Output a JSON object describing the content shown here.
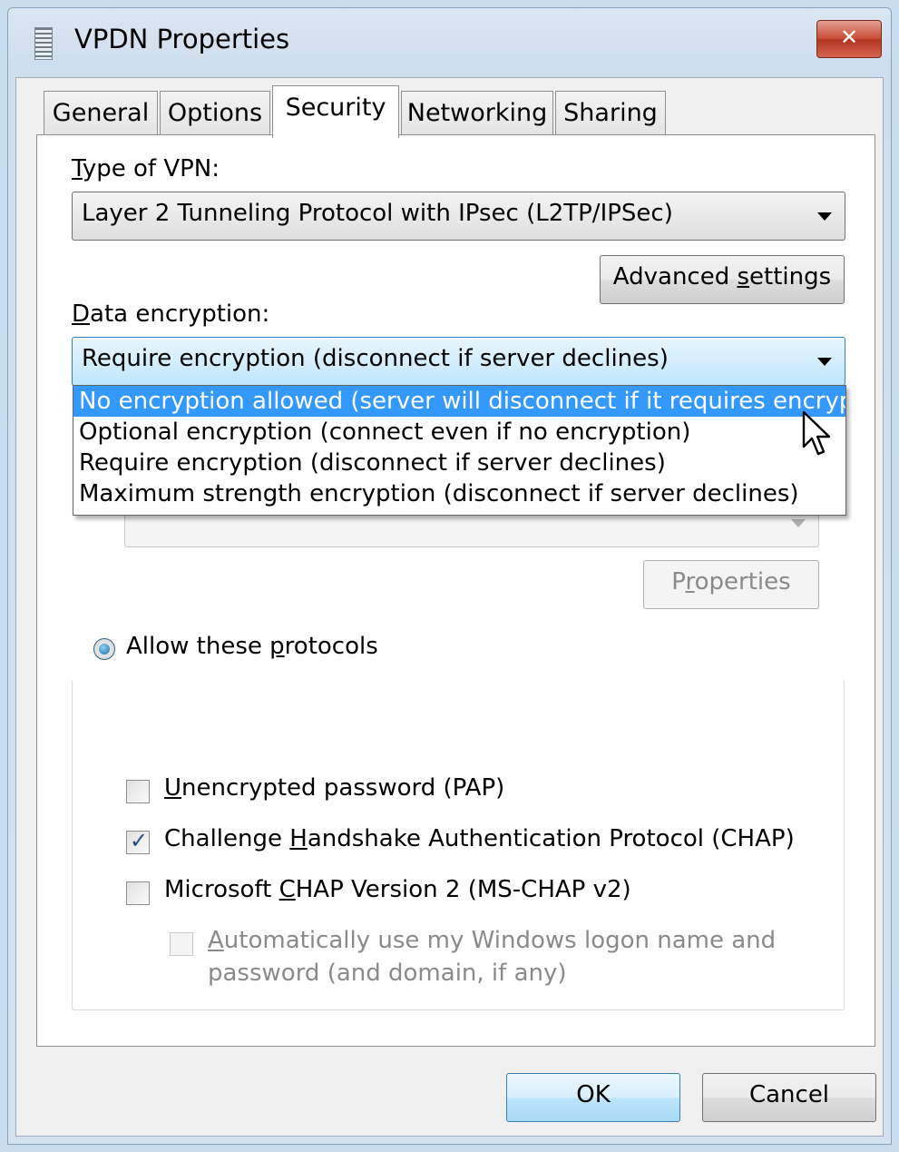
{
  "window": {
    "title": "VPDN Properties"
  },
  "tabs": [
    {
      "label": "General",
      "active": false
    },
    {
      "label": "Options",
      "active": false
    },
    {
      "label": "Security",
      "active": true
    },
    {
      "label": "Networking",
      "active": false
    },
    {
      "label": "Sharing",
      "active": false
    }
  ],
  "security": {
    "vpn_type_label_prefix": "T",
    "vpn_type_label_rest": "ype of VPN:",
    "vpn_type_value": "Layer 2 Tunneling Protocol with IPsec (L2TP/IPSec)",
    "advanced_settings_label_pre": "Advanced ",
    "advanced_settings_label_u": "s",
    "advanced_settings_label_post": "ettings",
    "data_encryption_label_prefix": "D",
    "data_encryption_label_rest": "ata encryption:",
    "data_encryption_value": "Require encryption (disconnect if server declines)",
    "data_encryption_options": [
      {
        "label": "No encryption allowed (server will disconnect if it requires encryption)",
        "highlighted": true
      },
      {
        "label": "Optional encryption (connect even if no encryption)",
        "highlighted": false
      },
      {
        "label": "Require encryption (disconnect if server declines)",
        "highlighted": false
      },
      {
        "label": "Maximum strength encryption (disconnect if server declines)",
        "highlighted": false
      }
    ],
    "properties_label_pre": "P",
    "properties_label_u": "r",
    "properties_label_post": "operties",
    "allow_protocols_pre": "Allow these ",
    "allow_protocols_u": "p",
    "allow_protocols_post": "rotocols",
    "allow_protocols_selected": true,
    "protocols": [
      {
        "pre": "",
        "u": "U",
        "post": "nencrypted password (PAP)",
        "checked": false,
        "enabled": true
      },
      {
        "pre": "Challenge ",
        "u": "H",
        "post": "andshake Authentication Protocol (CHAP)",
        "checked": true,
        "enabled": true
      },
      {
        "pre": "Microsoft ",
        "u": "C",
        "post": "HAP Version 2 (MS-CHAP v2)",
        "checked": false,
        "enabled": true
      }
    ],
    "auto_logon_line1_u": "A",
    "auto_logon_line1_rest": "utomatically use my Windows logon name and",
    "auto_logon_line2": "password (and domain, if any)",
    "auto_logon_checked": false,
    "auto_logon_enabled": false
  },
  "buttons": {
    "ok": "OK",
    "cancel": "Cancel"
  }
}
